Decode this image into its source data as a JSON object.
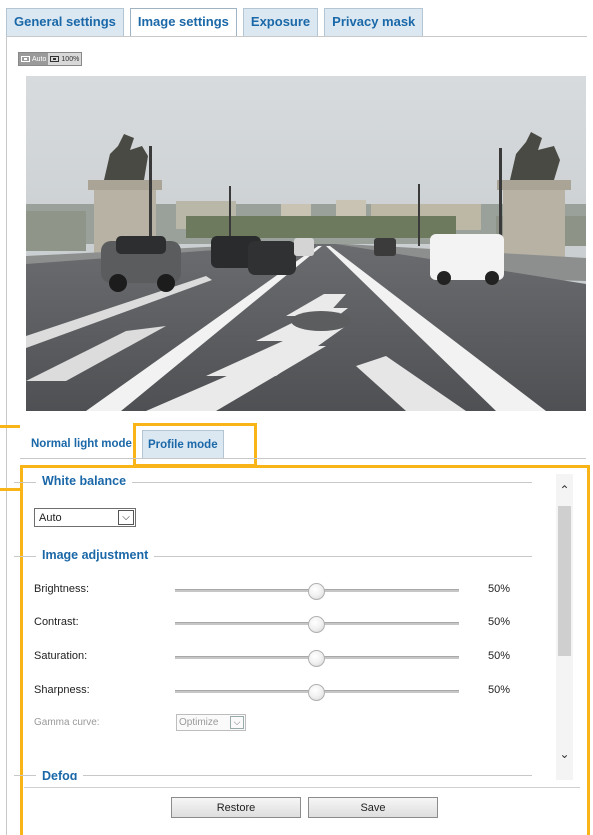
{
  "top_tabs": [
    {
      "label": "General settings"
    },
    {
      "label": "Image settings"
    },
    {
      "label": "Exposure"
    },
    {
      "label": "Privacy mask"
    }
  ],
  "zoom": {
    "auto_label": "Auto",
    "full_label": "100%"
  },
  "mode_tabs": [
    {
      "label": "Normal light mode"
    },
    {
      "label": "Profile mode"
    }
  ],
  "white_balance": {
    "legend": "White balance",
    "selected": "Auto"
  },
  "image_adjustment": {
    "legend": "Image adjustment",
    "rows": [
      {
        "label": "Brightness:",
        "value": "50%",
        "level": 0.5
      },
      {
        "label": "Contrast:",
        "value": "50%",
        "level": 0.5
      },
      {
        "label": "Saturation:",
        "value": "50%",
        "level": 0.5
      },
      {
        "label": "Sharpness:",
        "value": "50%",
        "level": 0.5
      }
    ],
    "gamma_label": "Gamma curve:",
    "gamma_value": "Optimize"
  },
  "defog": {
    "legend": "Defog"
  },
  "buttons": {
    "restore": "Restore",
    "save": "Save"
  },
  "colors": {
    "accent": "#1b68a8",
    "highlight": "#f9b417",
    "tab_bg": "#dbe8f2"
  }
}
